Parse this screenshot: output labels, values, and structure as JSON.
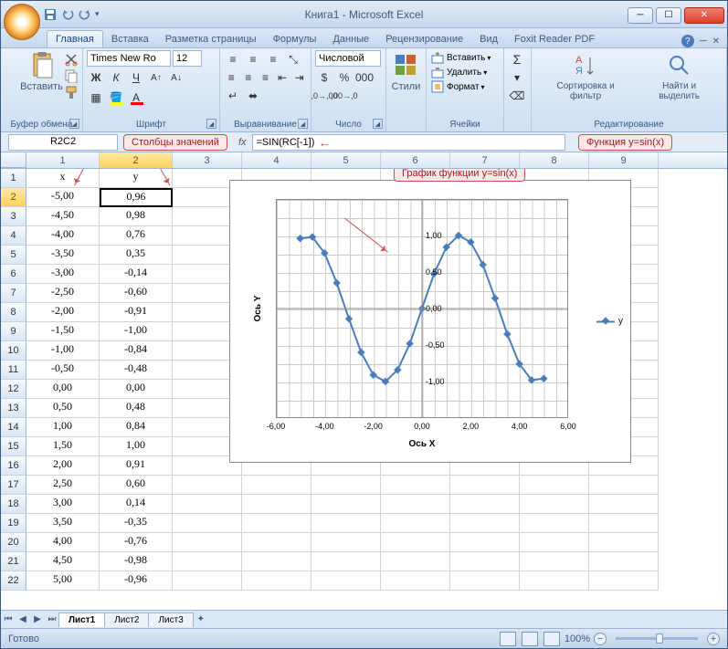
{
  "window": {
    "title": "Книга1 - Microsoft Excel"
  },
  "tabs": {
    "items": [
      "Главная",
      "Вставка",
      "Разметка страницы",
      "Формулы",
      "Данные",
      "Рецензирование",
      "Вид",
      "Foxit Reader PDF"
    ],
    "active": 0
  },
  "ribbon": {
    "clipboard": {
      "paste": "Вставить",
      "label": "Буфер обмена"
    },
    "font": {
      "name": "Times New Ro",
      "size": "12",
      "label": "Шрифт",
      "bold": "Ж",
      "italic": "К",
      "underline": "Ч"
    },
    "align": {
      "label": "Выравнивание"
    },
    "number": {
      "format": "Числовой",
      "label": "Число"
    },
    "styles": {
      "btn": "Стили"
    },
    "cells": {
      "insert": "Вставить",
      "delete": "Удалить",
      "format": "Формат",
      "label": "Ячейки"
    },
    "editing": {
      "sort": "Сортировка и фильтр",
      "find": "Найти и выделить",
      "label": "Редактирование"
    }
  },
  "namebox": "R2C2",
  "formula": "=SIN(RC[-1])",
  "callouts": {
    "cols": "Столбцы значений",
    "func": "Функция y=sin(x)",
    "chart": "График функции y=sin(x)"
  },
  "colheaders": [
    "1",
    "2",
    "3",
    "4",
    "5",
    "6",
    "7",
    "8",
    "9"
  ],
  "rows": [
    {
      "n": "1",
      "x": "x",
      "y": "y"
    },
    {
      "n": "2",
      "x": "-5,00",
      "y": "0,96"
    },
    {
      "n": "3",
      "x": "-4,50",
      "y": "0,98"
    },
    {
      "n": "4",
      "x": "-4,00",
      "y": "0,76"
    },
    {
      "n": "5",
      "x": "-3,50",
      "y": "0,35"
    },
    {
      "n": "6",
      "x": "-3,00",
      "y": "-0,14"
    },
    {
      "n": "7",
      "x": "-2,50",
      "y": "-0,60"
    },
    {
      "n": "8",
      "x": "-2,00",
      "y": "-0,91"
    },
    {
      "n": "9",
      "x": "-1,50",
      "y": "-1,00"
    },
    {
      "n": "10",
      "x": "-1,00",
      "y": "-0,84"
    },
    {
      "n": "11",
      "x": "-0,50",
      "y": "-0,48"
    },
    {
      "n": "12",
      "x": "0,00",
      "y": "0,00"
    },
    {
      "n": "13",
      "x": "0,50",
      "y": "0,48"
    },
    {
      "n": "14",
      "x": "1,00",
      "y": "0,84"
    },
    {
      "n": "15",
      "x": "1,50",
      "y": "1,00"
    },
    {
      "n": "16",
      "x": "2,00",
      "y": "0,91"
    },
    {
      "n": "17",
      "x": "2,50",
      "y": "0,60"
    },
    {
      "n": "18",
      "x": "3,00",
      "y": "0,14"
    },
    {
      "n": "19",
      "x": "3,50",
      "y": "-0,35"
    },
    {
      "n": "20",
      "x": "4,00",
      "y": "-0,76"
    },
    {
      "n": "21",
      "x": "4,50",
      "y": "-0,98"
    },
    {
      "n": "22",
      "x": "5,00",
      "y": "-0,96"
    }
  ],
  "chart_data": {
    "type": "line",
    "title": "",
    "xlabel": "Ось X",
    "ylabel": "Ось Y",
    "xlim": [
      -6,
      6
    ],
    "ylim": [
      -1.5,
      1.5
    ],
    "xticks": [
      "-6,00",
      "-4,00",
      "-2,00",
      "0,00",
      "2,00",
      "4,00",
      "6,00"
    ],
    "yticks": [
      "-1,00",
      "-0,50",
      "0,00",
      "0,50",
      "1,00"
    ],
    "series": [
      {
        "name": "y",
        "x": [
          -5,
          -4.5,
          -4,
          -3.5,
          -3,
          -2.5,
          -2,
          -1.5,
          -1,
          -0.5,
          0,
          0.5,
          1,
          1.5,
          2,
          2.5,
          3,
          3.5,
          4,
          4.5,
          5
        ],
        "y": [
          0.96,
          0.98,
          0.76,
          0.35,
          -0.14,
          -0.6,
          -0.91,
          -1.0,
          -0.84,
          -0.48,
          0.0,
          0.48,
          0.84,
          1.0,
          0.91,
          0.6,
          0.14,
          -0.35,
          -0.76,
          -0.98,
          -0.96
        ]
      }
    ],
    "legend": "y"
  },
  "sheets": {
    "items": [
      "Лист1",
      "Лист2",
      "Лист3"
    ],
    "active": 0
  },
  "status": {
    "ready": "Готово",
    "zoom": "100%"
  }
}
